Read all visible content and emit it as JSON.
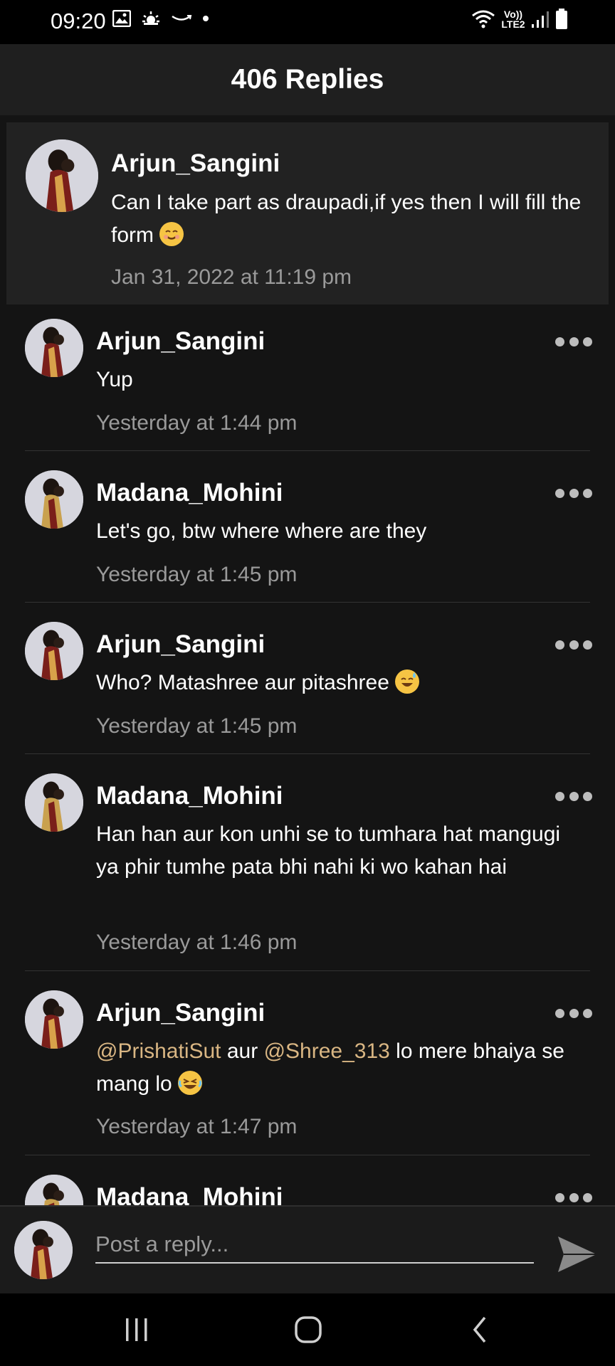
{
  "status_bar": {
    "time": "09:20",
    "network_label": "Vo)) LTE2",
    "icons": [
      "gallery-icon",
      "weather-icon",
      "amazon-icon",
      "dot-icon",
      "wifi-icon",
      "signal-icon",
      "battery-icon"
    ]
  },
  "header": {
    "title": "406 Replies"
  },
  "parent_comment": {
    "username": "Arjun_Sangini",
    "text": "Can I take part as draupadi,if yes then I will fill the form",
    "timestamp": "Jan 31, 2022 at 11:19 pm"
  },
  "replies": [
    {
      "username": "Arjun_Sangini",
      "text": "Yup",
      "timestamp": "Yesterday at 1:44 pm"
    },
    {
      "username": "Madana_Mohini",
      "text": "Let's go, btw where where are they",
      "timestamp": "Yesterday at 1:45 pm"
    },
    {
      "username": "Arjun_Sangini",
      "text": "Who? Matashree aur pitashree",
      "timestamp": "Yesterday at 1:45 pm"
    },
    {
      "username": "Madana_Mohini",
      "text": "Han han aur kon unhi se to tumhara hat mangugi ya phir tumhe pata bhi nahi ki wo kahan hai",
      "timestamp": "Yesterday at 1:46 pm"
    },
    {
      "username": "Arjun_Sangini",
      "mention_1": "@PrishatiSut",
      "text_1": " aur ",
      "mention_2": "@Shree_313",
      "text_2": " lo mere bhaiya se mang lo",
      "timestamp": "Yesterday at 1:47 pm"
    },
    {
      "username": "Madana_Mohini"
    }
  ],
  "composer": {
    "placeholder": "Post a reply..."
  },
  "colors": {
    "background": "#141414",
    "header_bg": "#1f1f1f",
    "parent_bg": "#222222",
    "timestamp": "#9a9a9a",
    "mention": "#d9b683"
  }
}
